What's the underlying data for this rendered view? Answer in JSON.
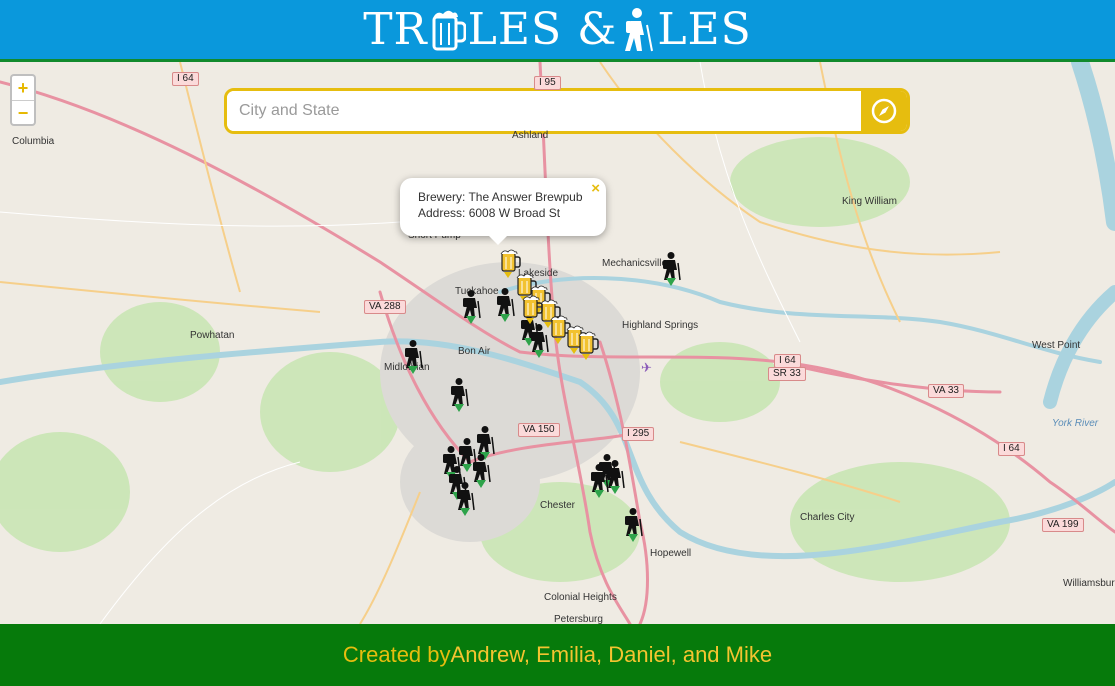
{
  "header": {
    "logo_text_left": "TR",
    "logo_text_mid": "LES & ",
    "logo_text_right": "LES",
    "logo_icons": [
      "beer-mug-icon",
      "hiker-icon"
    ]
  },
  "map": {
    "zoom_in": "+",
    "zoom_out": "−",
    "search": {
      "placeholder": "City and State",
      "button_icon": "compass-icon"
    },
    "popup": {
      "line1": "Brewery: The Answer Brewpub",
      "line2": "Address: 6008 W Broad St",
      "close": "×"
    },
    "places": [
      "Columbia",
      "Ashland",
      "King William",
      "Short Pump",
      "Lakeside",
      "Mechanicsville",
      "Tuckahoe",
      "Highland Springs",
      "Powhatan",
      "Bon Air",
      "Midlothian",
      "West Point",
      "Chester",
      "Charles City",
      "Hopewell",
      "Colonial Heights",
      "Petersburg",
      "Williamsburg",
      "York River"
    ],
    "shields": [
      "I 64",
      "I 95",
      "VA 288",
      "I 64",
      "SR 33",
      "VA 33",
      "VA 150",
      "I 295",
      "I 64",
      "VA 199"
    ]
  },
  "footer": {
    "prefix": "Created by ",
    "names": "Andrew, Emilia, Daniel, and Mike"
  },
  "colors": {
    "header": "#0a98dc",
    "accent": "#e6bd0f",
    "footer": "#067a0b"
  }
}
